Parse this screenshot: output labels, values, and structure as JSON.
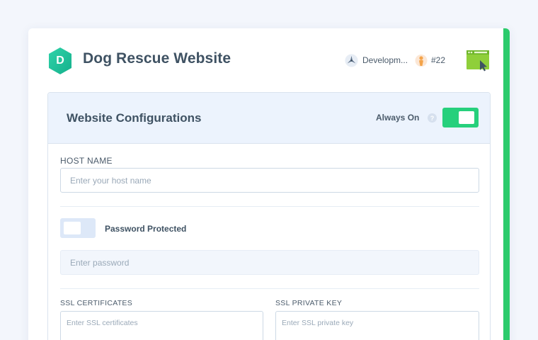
{
  "header": {
    "logo_letter": "D",
    "app_title": "Dog Rescue Website",
    "environment": {
      "label": "Developm...",
      "icon": "triblade-icon"
    },
    "build": {
      "label": "#22",
      "icon": "avatar-pin-icon"
    },
    "browser_icon": "browser-window-icon",
    "accent_color": "#2ccb6c"
  },
  "panel": {
    "title": "Website Configurations",
    "always_on_label": "Always On",
    "always_on_state": true,
    "help_glyph": "?",
    "host_name": {
      "label": "HOST NAME",
      "placeholder": "Enter your host name",
      "value": ""
    },
    "password": {
      "toggle_label": "Password Protected",
      "toggle_state": false,
      "placeholder": "Enter password",
      "value": ""
    },
    "ssl_certificates": {
      "label": "SSL CERTIFICATES",
      "placeholder": "Enter SSL certificates",
      "value": ""
    },
    "ssl_private_key": {
      "label": "SSL PRIVATE KEY",
      "placeholder": "Enter SSL private key",
      "value": ""
    }
  },
  "colors": {
    "toggle_on": "#26d07c",
    "toggle_off": "#dde8f8",
    "logo": "#21c59b",
    "title_text": "#3f5263"
  }
}
